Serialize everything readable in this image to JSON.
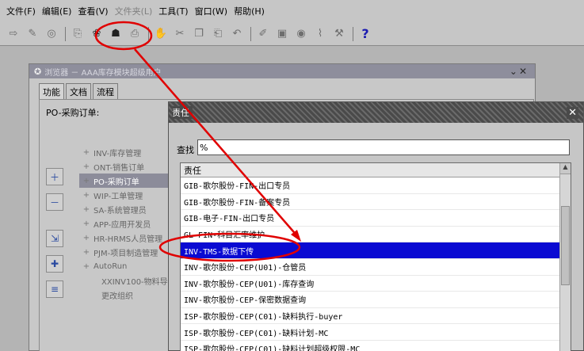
{
  "menubar": {
    "items": [
      {
        "label": "文件(F)",
        "disabled": false
      },
      {
        "label": "编辑(E)",
        "disabled": false
      },
      {
        "label": "查看(V)",
        "disabled": false
      },
      {
        "label": "文件夹(L)",
        "disabled": true
      },
      {
        "label": "工具(T)",
        "disabled": false
      },
      {
        "label": "窗口(W)",
        "disabled": false
      },
      {
        "label": "帮助(H)",
        "disabled": false
      }
    ]
  },
  "toolbar": {
    "icons": [
      "open-icon",
      "new-icon",
      "refresh-icon",
      "separator",
      "attach-icon",
      "zoom-icon",
      "navigator-icon",
      "print-icon",
      "separator",
      "hand-icon",
      "cut-icon",
      "copy-icon",
      "paste-icon",
      "undo-icon",
      "separator",
      "edit-icon",
      "folder-icon",
      "globe-icon",
      "clip-icon",
      "tool-icon",
      "separator",
      "help-icon"
    ],
    "help_label": "?"
  },
  "navigator": {
    "title": "浏览器 － AAA库存模块超级用户",
    "tabs": [
      {
        "label": "功能",
        "active": true
      },
      {
        "label": "文档",
        "active": false
      },
      {
        "label": "流程",
        "active": false
      }
    ],
    "pane_label": "PO-采购订单:",
    "tree": [
      {
        "label": "INV-库存管理",
        "prefix": "+",
        "selected": false,
        "child": false
      },
      {
        "label": "ONT-销售订单",
        "prefix": "+",
        "selected": false,
        "child": false
      },
      {
        "label": "PO-采购订单",
        "prefix": "+",
        "selected": true,
        "child": false
      },
      {
        "label": "WIP-工单管理",
        "prefix": "+",
        "selected": false,
        "child": false
      },
      {
        "label": "SA-系统管理员",
        "prefix": "+",
        "selected": false,
        "child": false
      },
      {
        "label": "APP-应用开发员",
        "prefix": "+",
        "selected": false,
        "child": false
      },
      {
        "label": "HR-HRMS人员管理",
        "prefix": "+",
        "selected": false,
        "child": false
      },
      {
        "label": "PJM-项目制造管理",
        "prefix": "+",
        "selected": false,
        "child": false
      },
      {
        "label": "AutoRun",
        "prefix": "+",
        "selected": false,
        "child": false
      },
      {
        "label": "XXINV100-物料导",
        "prefix": "",
        "selected": false,
        "child": true
      },
      {
        "label": "更改组织",
        "prefix": "",
        "selected": false,
        "child": true
      }
    ]
  },
  "dialog": {
    "title": "责任",
    "find_label": "查找",
    "find_value": "%",
    "column_header": "责任",
    "rows": [
      {
        "label": "GIB-歌尔股份-FIN-出口专员",
        "selected": false
      },
      {
        "label": "GIB-歌尔股份-FIN-备案专员",
        "selected": false
      },
      {
        "label": "GIB-电子-FIN-出口专员",
        "selected": false
      },
      {
        "label": "GL-FIN-科目汇率维护",
        "selected": false
      },
      {
        "label": "INV-TMS-数据下传",
        "selected": true
      },
      {
        "label": "INV-歌尔股份-CEP(U01)-仓管员",
        "selected": false
      },
      {
        "label": "INV-歌尔股份-CEP(U01)-库存查询",
        "selected": false
      },
      {
        "label": "INV-歌尔股份-CEP-保密数据查询",
        "selected": false
      },
      {
        "label": "ISP-歌尔股份-CEP(C01)-缺料执行-buyer",
        "selected": false
      },
      {
        "label": "ISP-歌尔股份-CEP(C01)-缺料计划-MC",
        "selected": false
      },
      {
        "label": "ISP-歌尔股份-CEP(C01)-缺料计划超级权限-MC",
        "selected": false
      }
    ]
  },
  "colors": {
    "selection": "#0a0ad2",
    "annotation": "#e00000"
  }
}
